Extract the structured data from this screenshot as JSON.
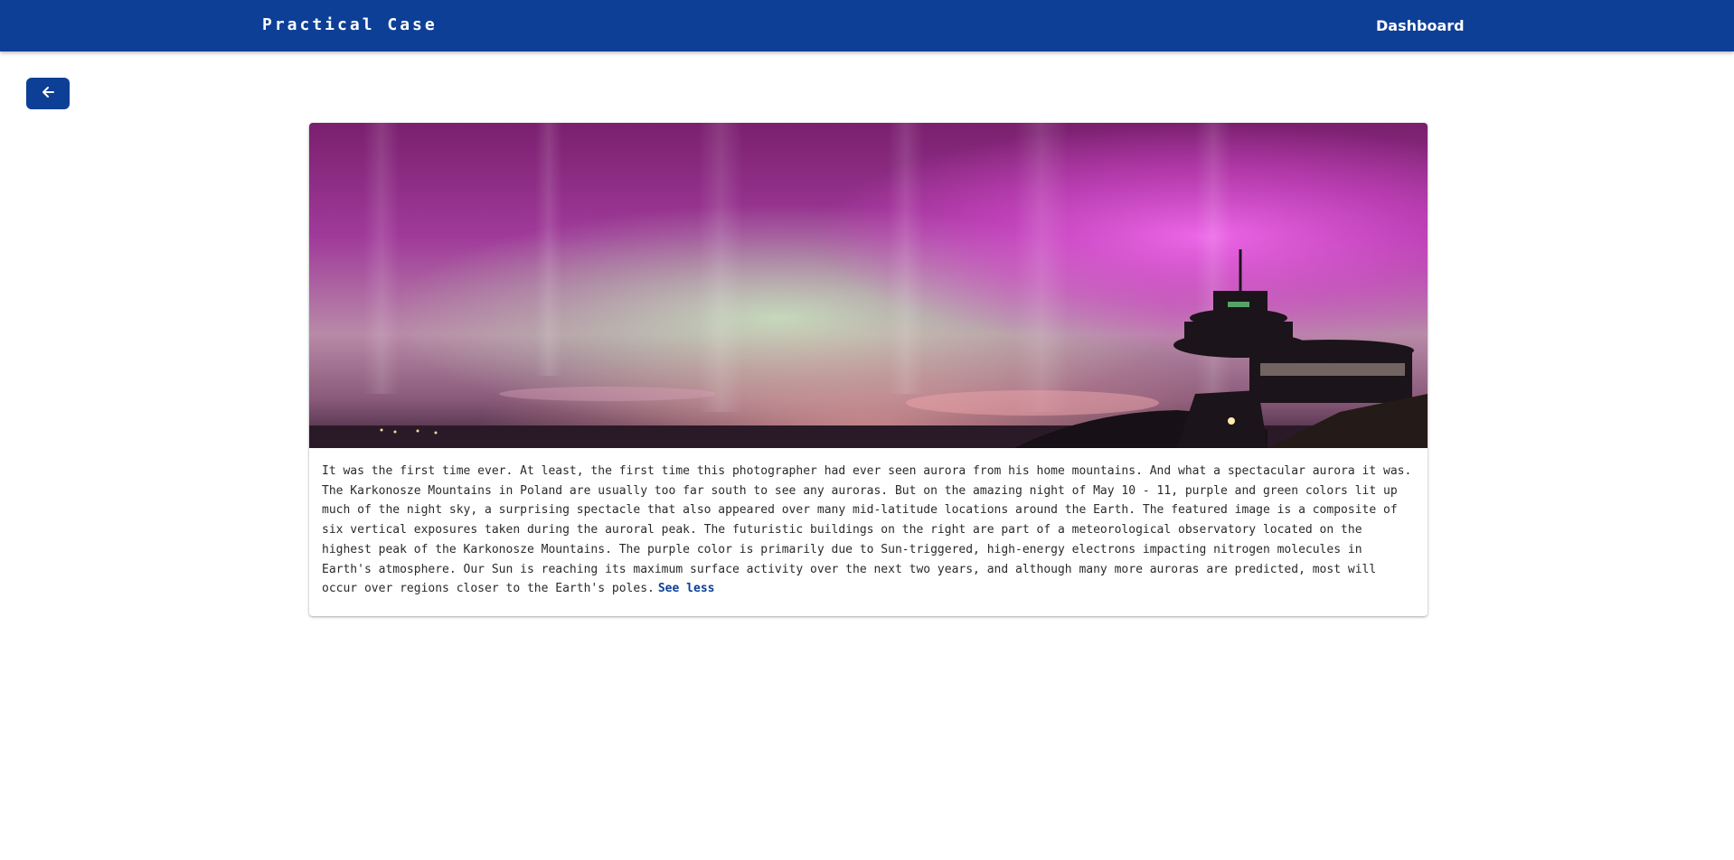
{
  "header": {
    "title": "Practical Case",
    "nav_dashboard": "Dashboard"
  },
  "back_button": {
    "icon": "arrow-left-icon"
  },
  "card": {
    "image_subject": "aurora-over-observatory",
    "description": "It was the first time ever. At least, the first time this photographer had ever seen aurora from his home mountains. And what a spectacular aurora it was. The Karkonosze Mountains in Poland are usually too far south to see any auroras. But on the amazing night of May 10 - 11, purple and green colors lit up much of the night sky, a surprising spectacle that also appeared over many mid-latitude locations around the Earth. The featured image is a composite of six vertical exposures taken during the auroral peak. The futuristic buildings on the right are part of a meteorological observatory located on the highest peak of the Karkonosze Mountains. The purple color is primarily due to Sun-triggered, high-energy electrons impacting nitrogen molecules in Earth's atmosphere. Our Sun is reaching its maximum surface activity over the next two years, and although many more auroras are predicted, most will occur over regions closer to the Earth's poles.",
    "see_less": "See less"
  },
  "colors": {
    "brand": "#0d3f96",
    "link": "#0d3f96"
  }
}
